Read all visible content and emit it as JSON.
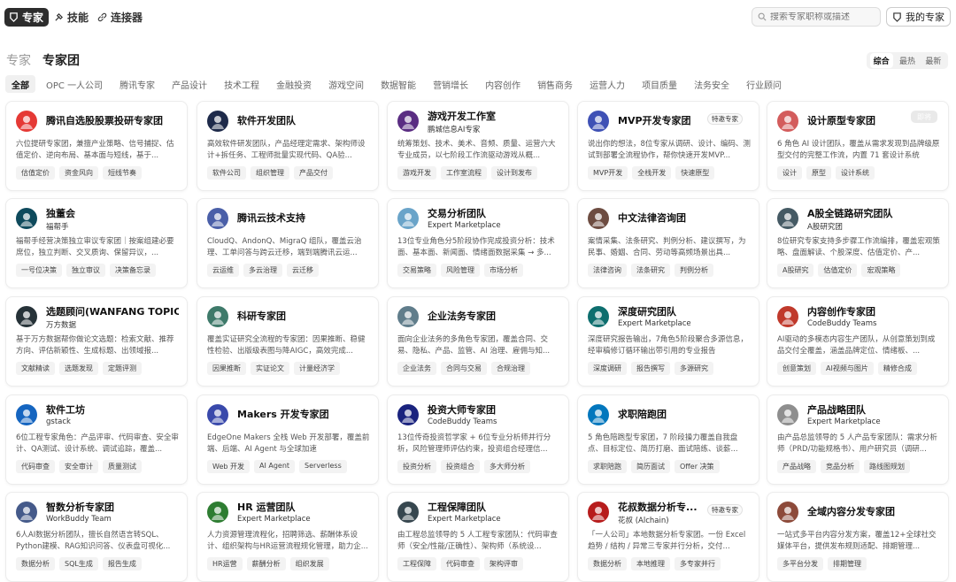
{
  "nav": {
    "tabs": [
      {
        "label": "专家",
        "icon": "expert-icon"
      },
      {
        "label": "技能",
        "icon": "skill-icon"
      },
      {
        "label": "连接器",
        "icon": "link-icon"
      }
    ],
    "search_placeholder": "搜索专家职称或描述",
    "my_experts": "我的专家"
  },
  "section": {
    "tab_expert": "专家",
    "tab_team": "专家团"
  },
  "sort": [
    "综合",
    "最热",
    "最新"
  ],
  "categories": [
    "全部",
    "OPC 一人公司",
    "腾讯专家",
    "产品设计",
    "技术工程",
    "金融投资",
    "游戏空间",
    "数据智能",
    "营销增长",
    "内容创作",
    "销售商务",
    "运营人力",
    "项目质量",
    "法务安全",
    "行业顾问"
  ],
  "badge_label": "特邀专家",
  "cards": [
    {
      "name": "腾讯自选股股票投研专家团",
      "sub": "",
      "desc": "六位提研专家团，兼擅产业策略、信号捕捉、估值定价、逆向布局、基本面与短线，基于...",
      "tags": [
        "估值定价",
        "资金风向",
        "短线节奏"
      ],
      "avatar": "chart-logo",
      "color": "#e53935",
      "badge": false,
      "chip": false
    },
    {
      "name": "软件开发团队",
      "sub": "",
      "desc": "高效软件研发团队，产品经理定需求、架构师设计+拆任务、工程师批量实现代码、QA验...",
      "tags": [
        "软件公司",
        "组织管理",
        "产品交付"
      ],
      "avatar": "globe-logo",
      "color": "#1e2a4a",
      "badge": false,
      "chip": false
    },
    {
      "name": "游戏开发工作室",
      "sub": "鹏城信息AI专家",
      "desc": "统筹策划、技术、美术、音频、质量、运营六大专业成员，以七阶段工作流驱动游戏从概...",
      "tags": [
        "游戏开发",
        "工作室流程",
        "设计到发布"
      ],
      "avatar": "game-logo",
      "color": "#5a2d82",
      "badge": false,
      "chip": false
    },
    {
      "name": "MVP开发专家团",
      "sub": "",
      "desc": "说出你的想法，8位专家从调研、设计、编码、测试到部署全流程协作，帮你快速开发MVP...",
      "tags": [
        "MVP开发",
        "全栈开发",
        "快速原型"
      ],
      "avatar": "mvp-logo",
      "color": "#3f51b5",
      "badge": true,
      "chip": false
    },
    {
      "name": "设计原型专家团",
      "sub": "",
      "desc": "6 角色 AI 设计团队，覆盖从需求发现到品牌级原型交付的完整工作流，内置 71 套设计系统",
      "tags": [
        "设计",
        "原型",
        "设计系统"
      ],
      "avatar": "design-logo",
      "color": "#d35c5c",
      "badge": false,
      "chip": true,
      "chip_label": "即将"
    },
    {
      "name": "独董会",
      "sub": "福帮手",
      "desc": "福帮手经营决策独立审议专家团｜按案组建必要席位，独立判断、交叉质询、保留异议，...",
      "tags": [
        "一号位决策",
        "独立审议",
        "决策备忘录"
      ],
      "avatar": "board-logo",
      "color": "#0e4a5c",
      "badge": false,
      "chip": false
    },
    {
      "name": "腾讯云技术支持",
      "sub": "",
      "desc": "CloudQ、AndonQ、MigraQ 组队，覆盖云治理、工单问答与跨云迁移，端到端腾讯云运...",
      "tags": [
        "云运维",
        "多云治理",
        "云迁移"
      ],
      "avatar": "cloud-logo",
      "color": "#4a5fa8",
      "badge": false,
      "chip": false
    },
    {
      "name": "交易分析团队",
      "sub": "Expert Marketplace",
      "desc": "13位专业角色分5阶段协作完成投资分析：技术面、基本面、新闻面、情绪面数据采集 → 多...",
      "tags": [
        "交易策略",
        "风险管理",
        "市场分析"
      ],
      "avatar": "trade-logo",
      "color": "#6aa4c9",
      "badge": false,
      "chip": false
    },
    {
      "name": "中文法律咨询团",
      "sub": "",
      "desc": "案情采集、法条研究、判例分析、建议撰写，为民事、婚姻、合同、劳动等高频场景出具...",
      "tags": [
        "法律咨询",
        "法条研究",
        "判例分析"
      ],
      "avatar": "law-logo",
      "color": "#6d4c41",
      "badge": false,
      "chip": false
    },
    {
      "name": "A股全链路研究团队",
      "sub": "A股研究团",
      "desc": "8位研究专家支持多步骤工作流编排，覆盖宏观策略、盘面解读、个股深度、估值定价、产...",
      "tags": [
        "A股研究",
        "估值定价",
        "宏观策略"
      ],
      "avatar": "person-logo",
      "color": "#455a64",
      "badge": false,
      "chip": false
    },
    {
      "name": "选题顾问(WANFANG TOPIC)",
      "sub": "万方数据",
      "desc": "基于万方数据帮你做论文选题：检索文献、推荐方向、评估新颖性、生成标题、出领域报...",
      "tags": [
        "文献精读",
        "选题发现",
        "定题评测"
      ],
      "avatar": "topic-logo",
      "color": "#263238",
      "badge": false,
      "chip": false
    },
    {
      "name": "科研专家团",
      "sub": "",
      "desc": "覆盖实证研究全流程的专家团：因果推断、稳健性检验、出版级表图与降AIGC，高效完成...",
      "tags": [
        "因果推断",
        "实证论文",
        "计量经济学"
      ],
      "avatar": "research-logo",
      "color": "#3e7a6a",
      "badge": false,
      "chip": false
    },
    {
      "name": "企业法务专家团",
      "sub": "",
      "desc": "面向企业法务的多角色专家团，覆盖合同、交易、隐私、产品、监管、AI 治理、雇佣与知...",
      "tags": [
        "企业法务",
        "合同与交易",
        "合规治理"
      ],
      "avatar": "legal-logo",
      "color": "#607d8b",
      "badge": false,
      "chip": false
    },
    {
      "name": "深度研究团队",
      "sub": "Expert Marketplace",
      "desc": "深度研究报告输出，7角色5阶段聚合多源信息，经审稿修订循环输出带引用的专业报告",
      "tags": [
        "深度调研",
        "报告撰写",
        "多源研究"
      ],
      "avatar": "deep-logo",
      "color": "#0d6e6e",
      "badge": false,
      "chip": false
    },
    {
      "name": "内容创作专家团",
      "sub": "CodeBuddy Teams",
      "desc": "AI驱动的多模态内容生产团队，从创意策划到成品交付全覆盖，涵盖品牌定位、情绪板、...",
      "tags": [
        "创意策划",
        "AI视频与图片",
        "精修合成"
      ],
      "avatar": "content-logo",
      "color": "#c0392b",
      "badge": false,
      "chip": false
    },
    {
      "name": "软件工坊",
      "sub": "gstack",
      "desc": "6位工程专家角色：产品评审、代码审查、安全审计、QA测试、设计系统、调试追踪，覆盖...",
      "tags": [
        "代码审查",
        "安全审计",
        "质量测试"
      ],
      "avatar": "workshop-logo",
      "color": "#1565c0",
      "badge": false,
      "chip": false
    },
    {
      "name": "Makers 开发专家团",
      "sub": "",
      "desc": "EdgeOne Makers 全栈 Web 开发部署，覆盖前端、后端、AI Agent 与全球加速",
      "tags": [
        "Web 开发",
        "AI Agent",
        "Serverless"
      ],
      "avatar": "makers-logo",
      "color": "#3949ab",
      "badge": false,
      "chip": false
    },
    {
      "name": "投资大师专家团",
      "sub": "CodeBuddy Teams",
      "desc": "13位传奇投资哲学家 + 6位专业分析师并行分析，风险管理师评估约束，投资组合经理信...",
      "tags": [
        "投资分析",
        "投资组合",
        "多大师分析"
      ],
      "avatar": "invest-logo",
      "color": "#1a237e",
      "badge": false,
      "chip": false
    },
    {
      "name": "求职陪跑团",
      "sub": "",
      "desc": "5 角色陪跑型专家团，7 阶段操力覆盖自我盘点、目标定位、简历打磨、面试陪练、谈薪...",
      "tags": [
        "求职陪跑",
        "简历面试",
        "Offer 决策"
      ],
      "avatar": "job-logo",
      "color": "#0277bd",
      "badge": false,
      "chip": false
    },
    {
      "name": "产品战略团队",
      "sub": "Expert Marketplace",
      "desc": "由产品总监领导的 5 人产品专家团队：需求分析师（PRD/功能规格书）、用户研究员（调研...",
      "tags": [
        "产品战略",
        "竞品分析",
        "路线图规划"
      ],
      "avatar": "strategy-logo",
      "color": "#8e8e8e",
      "badge": false,
      "chip": false
    },
    {
      "name": "智数分析专家团",
      "sub": "WorkBuddy Team",
      "desc": "6人AI数据分析团队，擅长自然语言转SQL、Python建模、RAG知识问答、仪表盘可视化...",
      "tags": [
        "数据分析",
        "SQL生成",
        "报告生成"
      ],
      "avatar": "data-logo",
      "color": "#455a8a",
      "badge": false,
      "chip": false
    },
    {
      "name": "HR 运营团队",
      "sub": "Expert Marketplace",
      "desc": "人力资源管理流程化，招聘筛选、薪酬体系设计、组织架构与HR运营流程规化管理，助力企...",
      "tags": [
        "HR运营",
        "薪酬分析",
        "组织发展"
      ],
      "avatar": "hr-logo",
      "color": "#2e7d32",
      "badge": false,
      "chip": false
    },
    {
      "name": "工程保障团队",
      "sub": "Expert Marketplace",
      "desc": "由工程总监领导的 5 人工程专家团队：代码审查师（安全/性能/正确性）、架构师（系统设...",
      "tags": [
        "工程保障",
        "代码审查",
        "架构评审"
      ],
      "avatar": "shield-logo",
      "color": "#37474f",
      "badge": false,
      "chip": false
    },
    {
      "name": "花叔数据分析专...",
      "sub": "花叔 (Alchain)",
      "desc": "「一人公司」本地数据分析专家团。一份 Excel 趋势 / 结构 / 异常三专家并行分析，交付...",
      "tags": [
        "数据分析",
        "本地推理",
        "多专家并行"
      ],
      "avatar": "hua-logo",
      "color": "#b71c1c",
      "badge": true,
      "chip": false
    },
    {
      "name": "全域内容分发专家团",
      "sub": "",
      "desc": "一站式多平台内容分发方案，覆盖12+全球社交媒体平台，提供发布规则适配、排期管理...",
      "tags": [
        "多平台分发",
        "排期管理"
      ],
      "avatar": "dist-logo",
      "color": "#8d4a3a",
      "badge": false,
      "chip": false
    }
  ]
}
